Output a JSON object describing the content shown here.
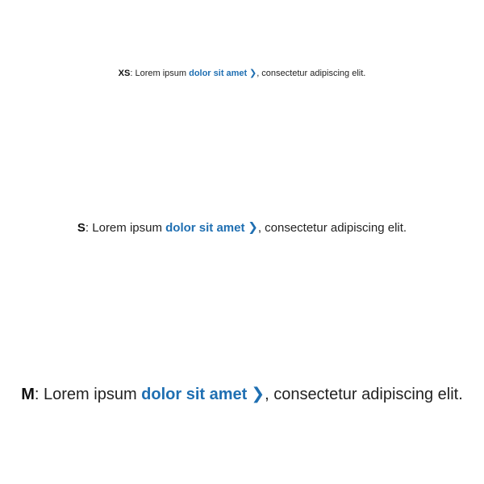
{
  "examples": [
    {
      "size_label": "XS",
      "prefix": ": Lorem ipsum ",
      "link_text": "dolor sit amet",
      "suffix": ", consectetur adipiscing elit."
    },
    {
      "size_label": "S",
      "prefix": ": Lorem ipsum ",
      "link_text": "dolor sit amet",
      "suffix": ", consectetur adipiscing elit."
    },
    {
      "size_label": "M",
      "prefix": ": Lorem ipsum ",
      "link_text": "dolor sit amet",
      "suffix": ", consectetur adipiscing elit."
    }
  ],
  "icons": {
    "link_arrow": "chevron-right-icon"
  },
  "colors": {
    "text": "#222222",
    "link": "#1f6fb2",
    "background": "#ffffff"
  }
}
